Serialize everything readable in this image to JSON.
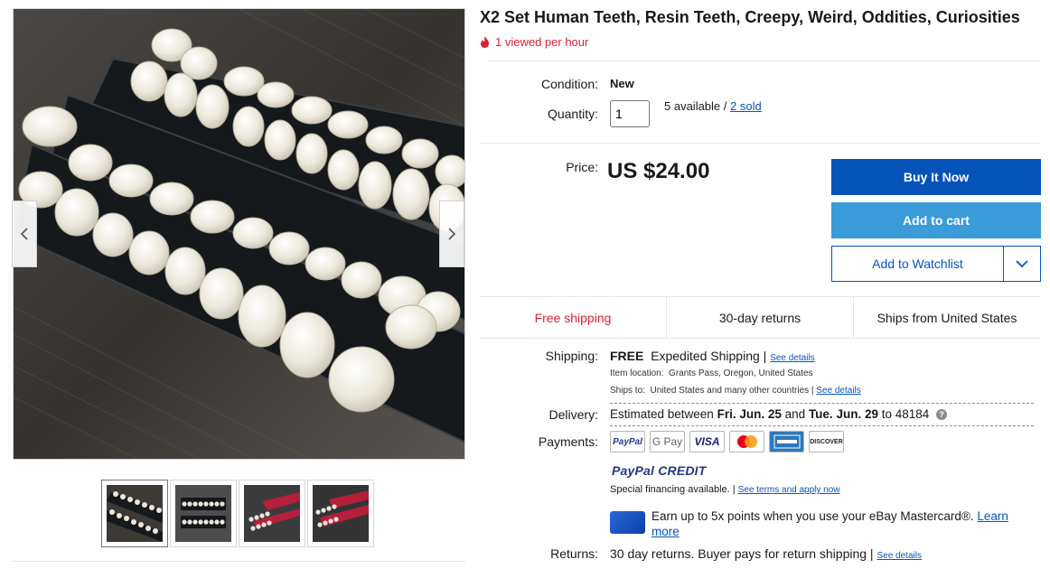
{
  "listing": {
    "title": "X2 Set Human Teeth, Resin Teeth, Creepy, Weird, Oddities, Curiosities",
    "views_text": "1 viewed per hour"
  },
  "condition": {
    "label": "Condition:",
    "value": "New"
  },
  "quantity": {
    "label": "Quantity:",
    "value": "1",
    "available": "5 available /",
    "sold": "2 sold"
  },
  "price": {
    "label": "Price:",
    "value": "US $24.00"
  },
  "actions": {
    "buy_now": "Buy It Now",
    "add_to_cart": "Add to cart",
    "watchlist": "Add to Watchlist"
  },
  "highlights": [
    "Free shipping",
    "30-day returns",
    "Ships from United States"
  ],
  "shipping": {
    "label": "Shipping:",
    "free": "FREE",
    "method": "Expedited Shipping |",
    "see_details": "See details",
    "location_label": "Item location:",
    "location": "Grants Pass, Oregon, United States",
    "ships_to_label": "Ships to:",
    "ships_to": "United States and many other countries |",
    "ships_to_link": "See details"
  },
  "delivery": {
    "label": "Delivery:",
    "prefix": "Estimated between",
    "start": "Fri. Jun. 25",
    "and": "and",
    "end": "Tue. Jun. 29",
    "to": "to 48184",
    "help": "?"
  },
  "payments": {
    "label": "Payments:",
    "methods": [
      "PayPal",
      "G Pay",
      "VISA",
      "Mastercard",
      "American Express",
      "DISCOVER"
    ],
    "paypal_credit": "PayPal CREDIT",
    "financing": "Special financing available. |",
    "financing_link": "See terms and apply now",
    "mastercard_offer": "Earn up to 5x points when you use your eBay Mastercard®.",
    "mastercard_link_1": "Learn",
    "mastercard_link_2": "more"
  },
  "returns": {
    "label": "Returns:",
    "text": "30 day returns. Buyer pays for return shipping |",
    "link": "See details"
  },
  "colors": {
    "ebay_blue": "#0654ba",
    "cart_blue": "#3a9bd8",
    "alert_red": "#dd1e31"
  },
  "icons": {
    "views": "flame-icon",
    "prev": "chevron-left-icon",
    "next": "chevron-right-icon",
    "watch_menu": "chevron-down-icon",
    "help": "question-circle-icon",
    "mastercard": "credit-card-icon"
  }
}
